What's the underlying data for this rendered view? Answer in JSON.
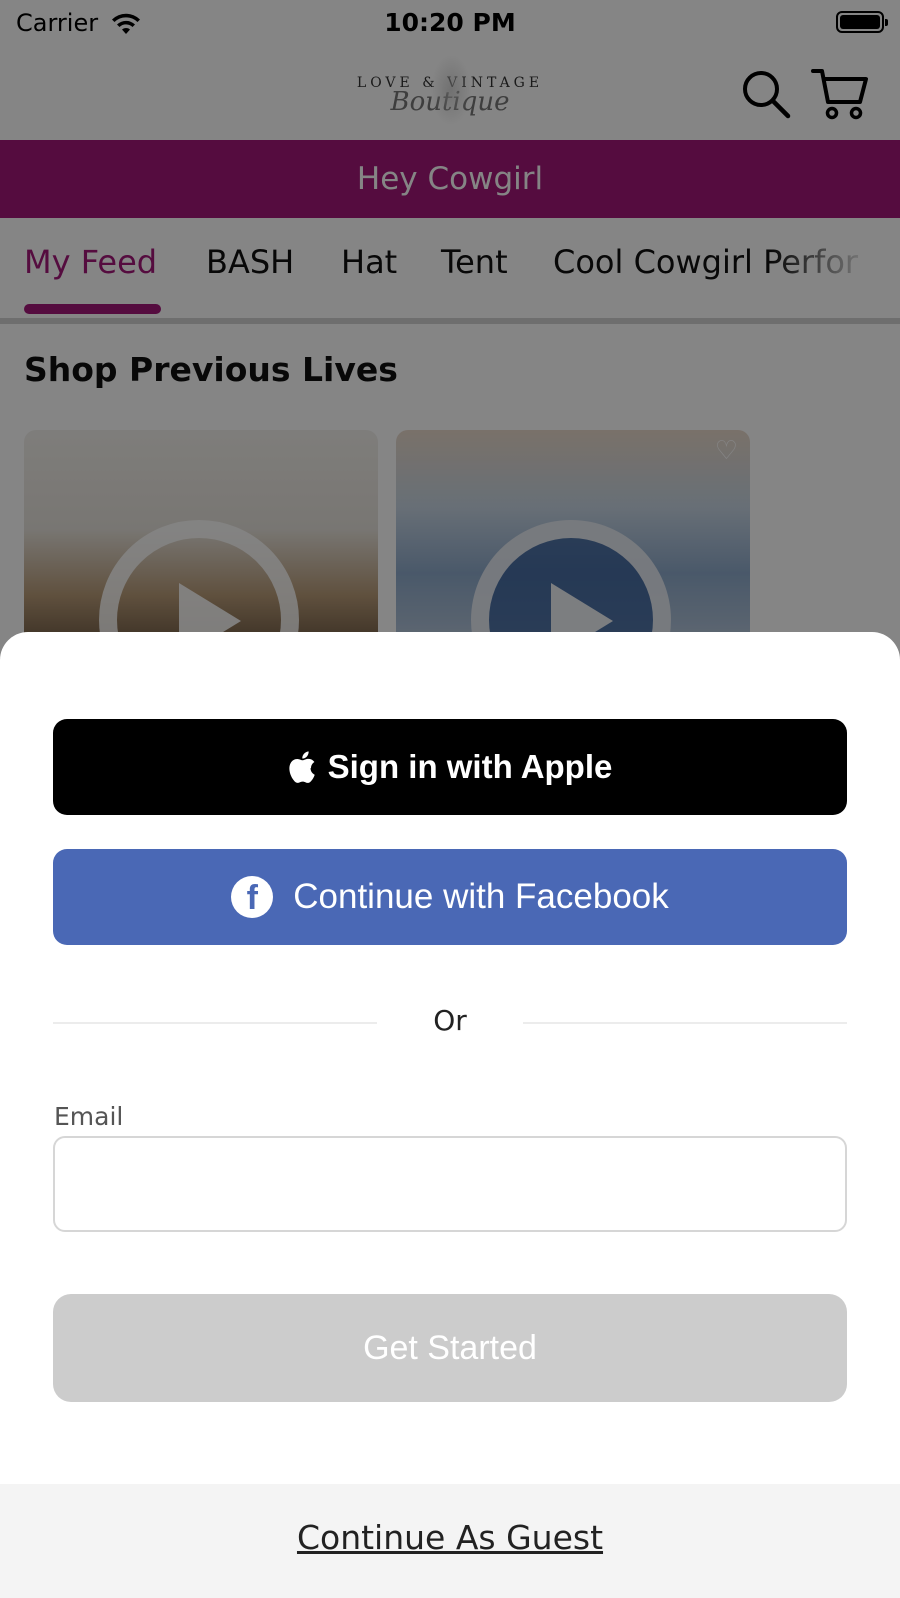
{
  "status_bar": {
    "carrier": "Carrier",
    "time": "10:20 PM"
  },
  "header": {
    "logo_top": "LOVE & VINTAGE",
    "logo_script": "Boutique",
    "icons": {
      "search": "search-icon",
      "cart": "cart-icon"
    }
  },
  "banner": {
    "text": "Hey Cowgirl",
    "color": "#a3177a"
  },
  "tabs": [
    {
      "label": "My Feed",
      "active": true
    },
    {
      "label": "BASH",
      "active": false
    },
    {
      "label": "Hat",
      "active": false
    },
    {
      "label": "Tent",
      "active": false
    },
    {
      "label": "Cool Cowgirl Perfor",
      "active": false
    }
  ],
  "section": {
    "title": "Shop Previous Lives"
  },
  "auth_sheet": {
    "apple_label": "Sign in with Apple",
    "facebook_label": "Continue with Facebook",
    "divider_text": "Or",
    "email_label": "Email",
    "email_value": "",
    "email_placeholder": "",
    "submit_label": "Get Started",
    "guest_label": "Continue As Guest",
    "colors": {
      "apple_bg": "#000000",
      "facebook_bg": "#4a68b5",
      "submit_disabled_bg": "#cccccc"
    }
  }
}
